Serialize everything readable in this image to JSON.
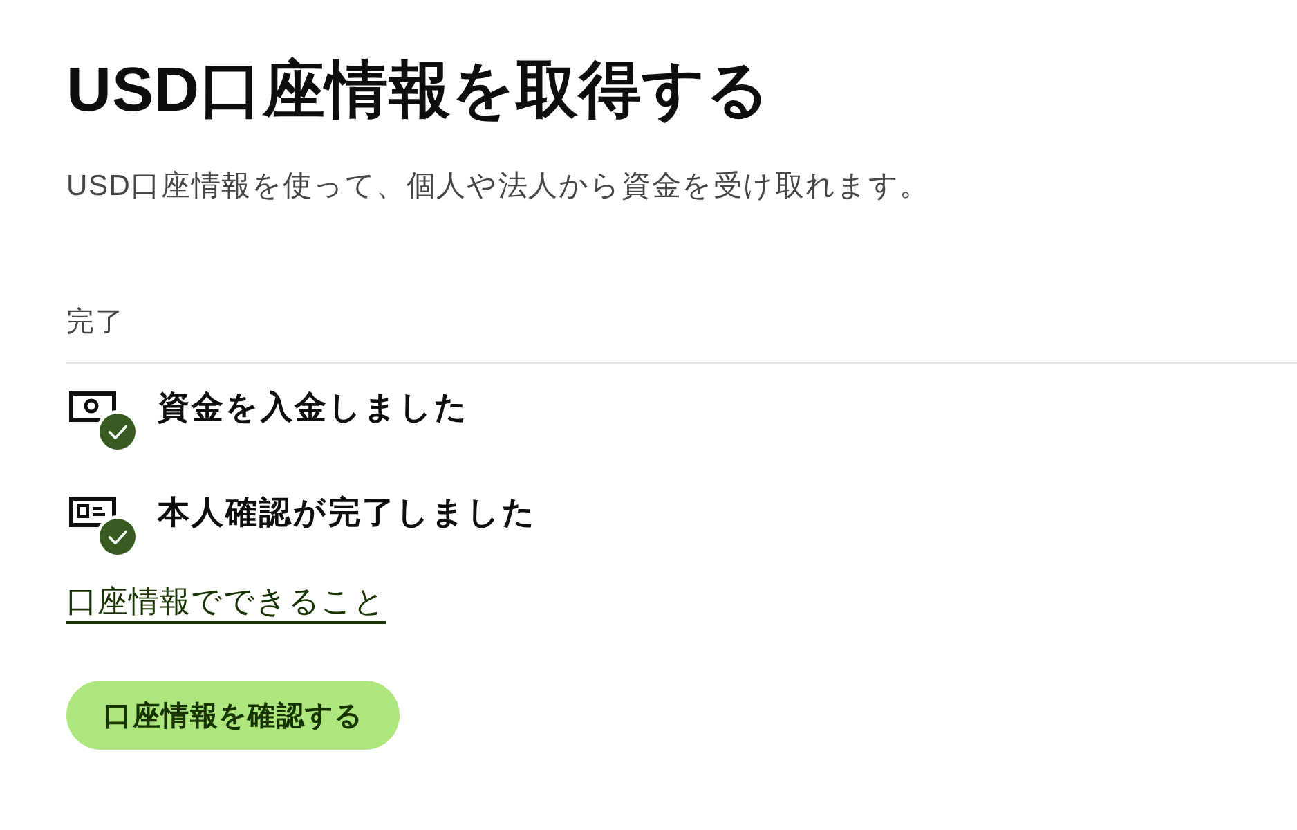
{
  "page": {
    "title": "USD口座情報を取得する",
    "subtitle": "USD口座情報を使って、個人や法人から資金を受け取れます。"
  },
  "completed": {
    "heading": "完了",
    "steps": [
      {
        "kind": "banknote",
        "label": "資金を入金しました",
        "done": true
      },
      {
        "kind": "id-card",
        "label": "本人確認が完了しました",
        "done": true
      }
    ]
  },
  "link": "口座情報でできること",
  "button": "口座情報を確認する"
}
